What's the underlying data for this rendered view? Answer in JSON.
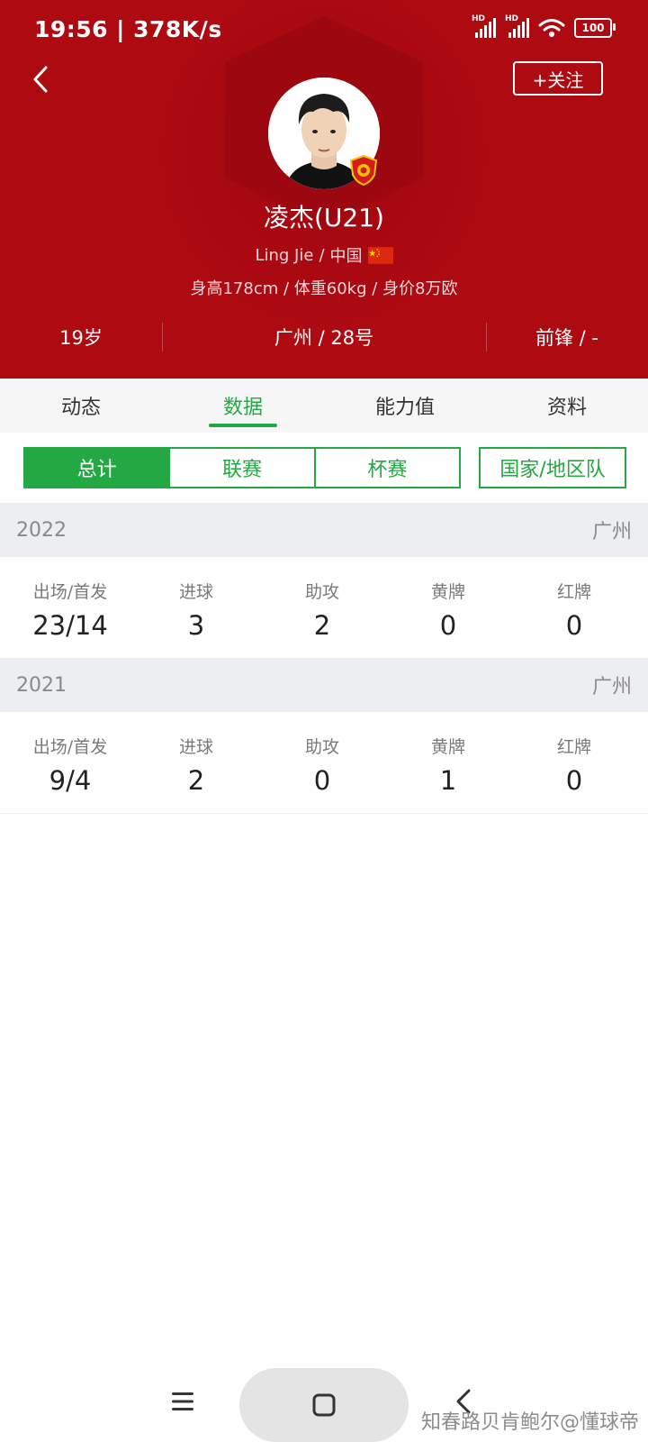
{
  "status_bar": {
    "time": "19:56",
    "speed": "378K/s",
    "battery": "100",
    "network_badge": "HD"
  },
  "header": {
    "follow_label": "+关注",
    "player_name": "凌杰(U21)",
    "english_name": "Ling Jie",
    "nationality": "中国",
    "separator": "/",
    "body_info": "身高178cm / 体重60kg / 身价8万欧",
    "age": "19岁",
    "club_number": "广州 / 28号",
    "position": "前锋 / -"
  },
  "tabs": [
    {
      "label": "动态",
      "active": false
    },
    {
      "label": "数据",
      "active": true
    },
    {
      "label": "能力值",
      "active": false
    },
    {
      "label": "资料",
      "active": false
    }
  ],
  "segments": [
    {
      "label": "总计",
      "active": true
    },
    {
      "label": "联赛",
      "active": false
    },
    {
      "label": "杯赛",
      "active": false
    }
  ],
  "national_segment": "国家/地区队",
  "stat_labels": [
    "出场/首发",
    "进球",
    "助攻",
    "黄牌",
    "红牌"
  ],
  "seasons": [
    {
      "year": "2022",
      "team": "广州",
      "values": [
        "23/14",
        "3",
        "2",
        "0",
        "0"
      ]
    },
    {
      "year": "2021",
      "team": "广州",
      "values": [
        "9/4",
        "2",
        "0",
        "1",
        "0"
      ]
    }
  ],
  "watermark": "知春路贝肯鲍尔@懂球帝",
  "colors": {
    "header_red": "#ae0a12",
    "accent_green": "#23a843"
  }
}
